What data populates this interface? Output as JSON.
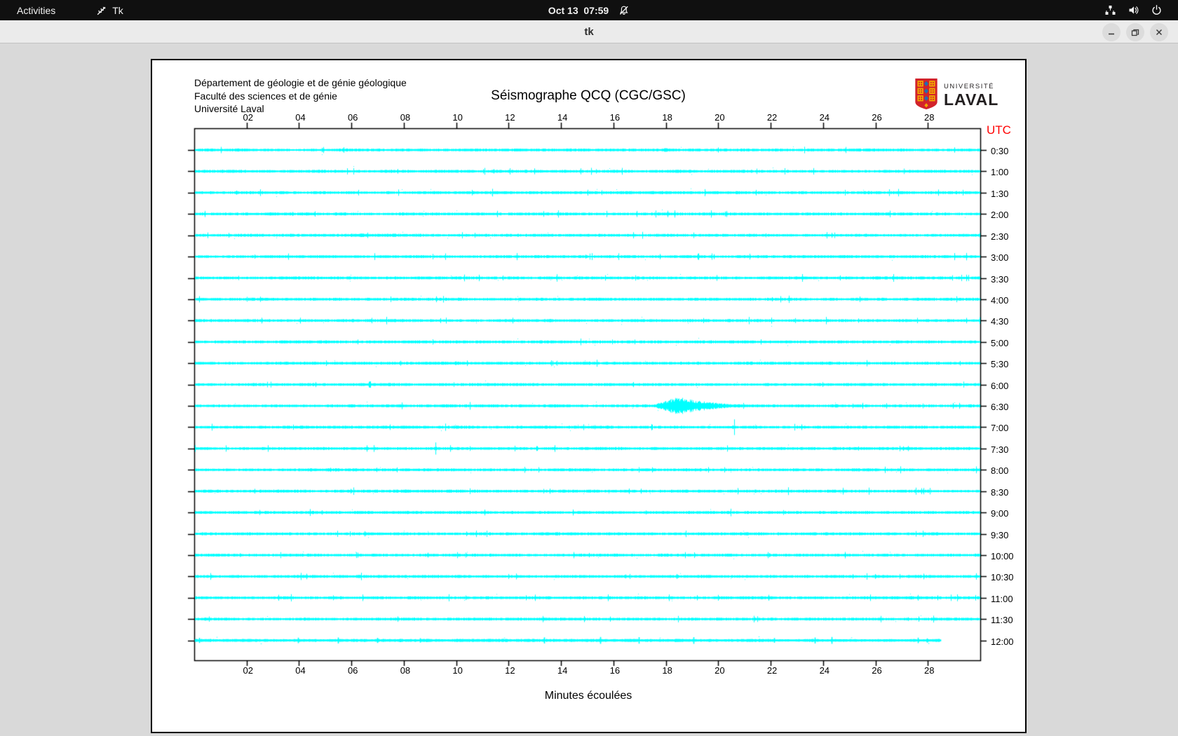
{
  "topbar": {
    "activities": "Activities",
    "app_name": "Tk",
    "clock": "Oct 13  07:59",
    "icons": [
      "tk-icon",
      "notifications-muted-icon",
      "network-icon",
      "volume-icon",
      "power-icon"
    ]
  },
  "titlebar": {
    "title": "tk",
    "buttons": [
      "minimize",
      "maximize",
      "close"
    ]
  },
  "seismograph": {
    "institution_lines": [
      "Département de géologie et de génie géologique",
      "Faculté des sciences et de génie",
      "Université Laval"
    ],
    "title": "Séismographe QCQ (CGC/GSC)",
    "logo": {
      "line1": "UNIVERSITÉ",
      "line2": "LAVAL"
    },
    "utc_label": "UTC",
    "xlabel": "Minutes écoulées"
  },
  "chart_data": {
    "type": "line",
    "subtype": "seismogram-helicorder",
    "title": "Séismographe QCQ (CGC/GSC)",
    "xlabel": "Minutes écoulées",
    "x_range": [
      0,
      30
    ],
    "x_tick_labels": [
      "02",
      "04",
      "06",
      "08",
      "10",
      "12",
      "14",
      "16",
      "18",
      "20",
      "22",
      "24",
      "26",
      "28"
    ],
    "right_axis_label": "UTC",
    "trace_color": "#00ffff",
    "frame_color": "#000000",
    "utc_color": "#ff0000",
    "rows": [
      {
        "utc": "0:30",
        "events": [
          {
            "type": "burst",
            "m": 18.0,
            "amp": 3,
            "w": 1.0
          }
        ]
      },
      {
        "utc": "1:00",
        "events": [
          {
            "type": "burst",
            "m": 7.3,
            "amp": 2.2,
            "w": 0.5
          },
          {
            "type": "burst",
            "m": 9.8,
            "amp": 2,
            "w": 0.4
          },
          {
            "type": "burst",
            "m": 28.6,
            "amp": 2.3,
            "w": 0.5
          }
        ]
      },
      {
        "utc": "1:30",
        "events": [
          {
            "type": "burst",
            "m": 3.3,
            "amp": 2.4,
            "w": 0.5
          },
          {
            "type": "burst",
            "m": 7.4,
            "amp": 2.4,
            "w": 0.5
          },
          {
            "type": "burst",
            "m": 11.6,
            "amp": 2.4,
            "w": 0.6
          }
        ]
      },
      {
        "utc": "2:00",
        "events": [
          {
            "type": "burst",
            "m": 17.7,
            "amp": 2,
            "w": 0.4
          }
        ]
      },
      {
        "utc": "2:30",
        "events": [
          {
            "type": "burst",
            "m": 25.7,
            "amp": 2,
            "w": 0.4
          },
          {
            "type": "burst",
            "m": 29.3,
            "amp": 2.8,
            "w": 0.8
          }
        ]
      },
      {
        "utc": "3:00",
        "events": [
          {
            "type": "burst",
            "m": 18.9,
            "amp": 2.3,
            "w": 0.8
          }
        ]
      },
      {
        "utc": "3:30",
        "events": [
          {
            "type": "burst",
            "m": 1.2,
            "amp": 2,
            "w": 0.4
          },
          {
            "type": "burst",
            "m": 16.1,
            "amp": 2,
            "w": 0.6
          }
        ]
      },
      {
        "utc": "4:00",
        "events": []
      },
      {
        "utc": "4:30",
        "events": [
          {
            "type": "burst",
            "m": 5.7,
            "amp": 2.4,
            "w": 0.4
          }
        ]
      },
      {
        "utc": "5:00",
        "events": []
      },
      {
        "utc": "5:30",
        "events": [
          {
            "type": "burst",
            "m": 10.0,
            "amp": 2.8,
            "w": 0.5
          },
          {
            "type": "burst",
            "m": 17.9,
            "amp": 2,
            "w": 0.5
          },
          {
            "type": "burst",
            "m": 20.1,
            "amp": 2,
            "w": 0.4
          }
        ]
      },
      {
        "utc": "6:00",
        "events": [
          {
            "type": "spike",
            "m": 6.7,
            "amp": 5,
            "w": 0.1
          },
          {
            "type": "burst",
            "m": 22.9,
            "amp": 2.6,
            "w": 0.8
          }
        ]
      },
      {
        "utc": "6:30",
        "events": [
          {
            "type": "burst",
            "m": 18.5,
            "amp": 13,
            "w": 2.2
          }
        ]
      },
      {
        "utc": "7:00",
        "events": [
          {
            "type": "spike",
            "m": 20.6,
            "amp": 11,
            "w": 0.1
          }
        ]
      },
      {
        "utc": "7:30",
        "events": [
          {
            "type": "spike",
            "m": 9.2,
            "amp": 8,
            "w": 0.1
          }
        ]
      },
      {
        "utc": "8:00",
        "events": []
      },
      {
        "utc": "8:30",
        "events": []
      },
      {
        "utc": "9:00",
        "events": []
      },
      {
        "utc": "9:30",
        "events": []
      },
      {
        "utc": "10:00",
        "events": [
          {
            "type": "burst",
            "m": 9.5,
            "amp": 2,
            "w": 0.4
          }
        ]
      },
      {
        "utc": "10:30",
        "events": []
      },
      {
        "utc": "11:00",
        "events": []
      },
      {
        "utc": "11:30",
        "events": [
          {
            "type": "spike",
            "m": 26.2,
            "amp": 5,
            "w": 0.1
          }
        ]
      },
      {
        "utc": "12:00",
        "events": [
          {
            "type": "burst",
            "m": 16.6,
            "amp": 2.6,
            "w": 0.6
          }
        ],
        "end_minute": 28.5,
        "bold": true
      }
    ]
  }
}
